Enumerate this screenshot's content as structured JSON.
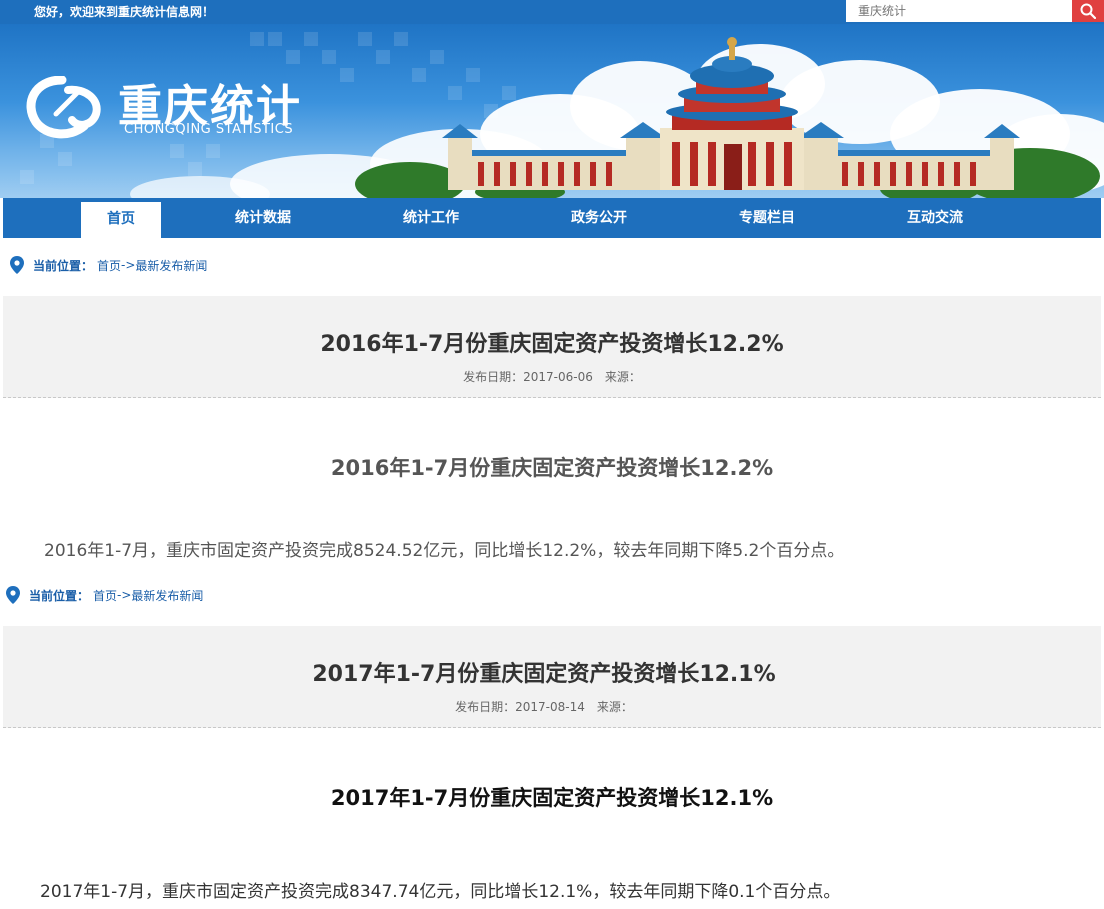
{
  "topbar": {
    "welcome": "您好，欢迎来到重庆统计信息网！",
    "search_placeholder": "重庆统计",
    "search_icon": "search-icon"
  },
  "banner": {
    "logo_cn": "重庆统计",
    "logo_en": "CHONGQING STATISTICS"
  },
  "nav": {
    "items": [
      {
        "label": "首页",
        "active": true
      },
      {
        "label": "统计数据"
      },
      {
        "label": "统计工作"
      },
      {
        "label": "政务公开"
      },
      {
        "label": "专题栏目"
      },
      {
        "label": "互动交流"
      }
    ]
  },
  "colors": {
    "primary": "#1e6fbd",
    "search_button": "#e04040",
    "header_bg": "#f2f2f2"
  },
  "articles": [
    {
      "breadcrumb": {
        "label": "当前位置：",
        "home": "首页",
        "sep": "->",
        "current": "最新发布新闻"
      },
      "title": "2016年1-7月份重庆固定资产投资增长12.2%",
      "meta": "发布日期：2017-06-06　来源：",
      "subtitle": "2016年1-7月份重庆固定资产投资增长12.2%",
      "body": "2016年1-7月，重庆市固定资产投资完成8524.52亿元，同比增长12.2%，较去年同期下降5.2个百分点。"
    },
    {
      "breadcrumb": {
        "label": "当前位置：",
        "home": "首页",
        "sep": "->",
        "current": "最新发布新闻"
      },
      "title": "2017年1-7月份重庆固定资产投资增长12.1%",
      "meta": "发布日期：2017-08-14　来源：",
      "subtitle": "2017年1-7月份重庆固定资产投资增长12.1%",
      "body": "2017年1-7月，重庆市固定资产投资完成8347.74亿元，同比增长12.1%，较去年同期下降0.1个百分点。"
    }
  ]
}
